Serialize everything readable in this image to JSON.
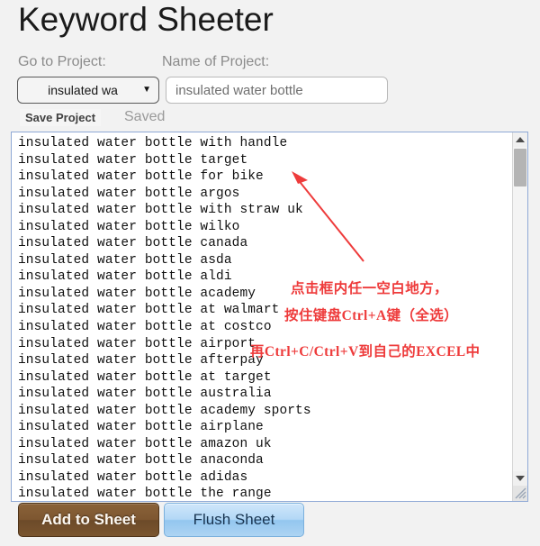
{
  "header": {
    "app_title": "Keyword Sheeter"
  },
  "toolbar": {
    "goto_project_label": "Go to Project:",
    "name_of_project_label": "Name of Project:",
    "project_select_value": "insulated wa",
    "project_select_caret": "chevron-down-icon",
    "project_name_value": "insulated water bottle",
    "project_name_placeholder": "insulated water bottle",
    "save_project_label": "Save Project",
    "save_status": "Saved"
  },
  "keywords": [
    "insulated water bottle with handle",
    "insulated water bottle target",
    "insulated water bottle for bike",
    "insulated water bottle argos",
    "insulated water bottle with straw uk",
    "insulated water bottle wilko",
    "insulated water bottle canada",
    "insulated water bottle asda",
    "insulated water bottle aldi",
    "insulated water bottle academy",
    "insulated water bottle at walmart",
    "insulated water bottle at costco",
    "insulated water bottle airport",
    "insulated water bottle afterpay",
    "insulated water bottle at target",
    "insulated water bottle australia",
    "insulated water bottle academy sports",
    "insulated water bottle airplane",
    "insulated water bottle amazon uk",
    "insulated water bottle anaconda",
    "insulated water bottle adidas",
    "insulated water bottle the range"
  ],
  "annotation": {
    "color": "#ee3b3b",
    "line1": "点击框内任一空白地方，",
    "line2": "按住键盘Ctrl+A键（全选）",
    "line3": "再Ctrl+C/Ctrl+V到自己的EXCEL中"
  },
  "footer": {
    "add_to_sheet_label": "Add to Sheet",
    "flush_sheet_label": "Flush Sheet",
    "add_button_color": "#7d5630",
    "flush_button_color": "#b3d8f6"
  }
}
